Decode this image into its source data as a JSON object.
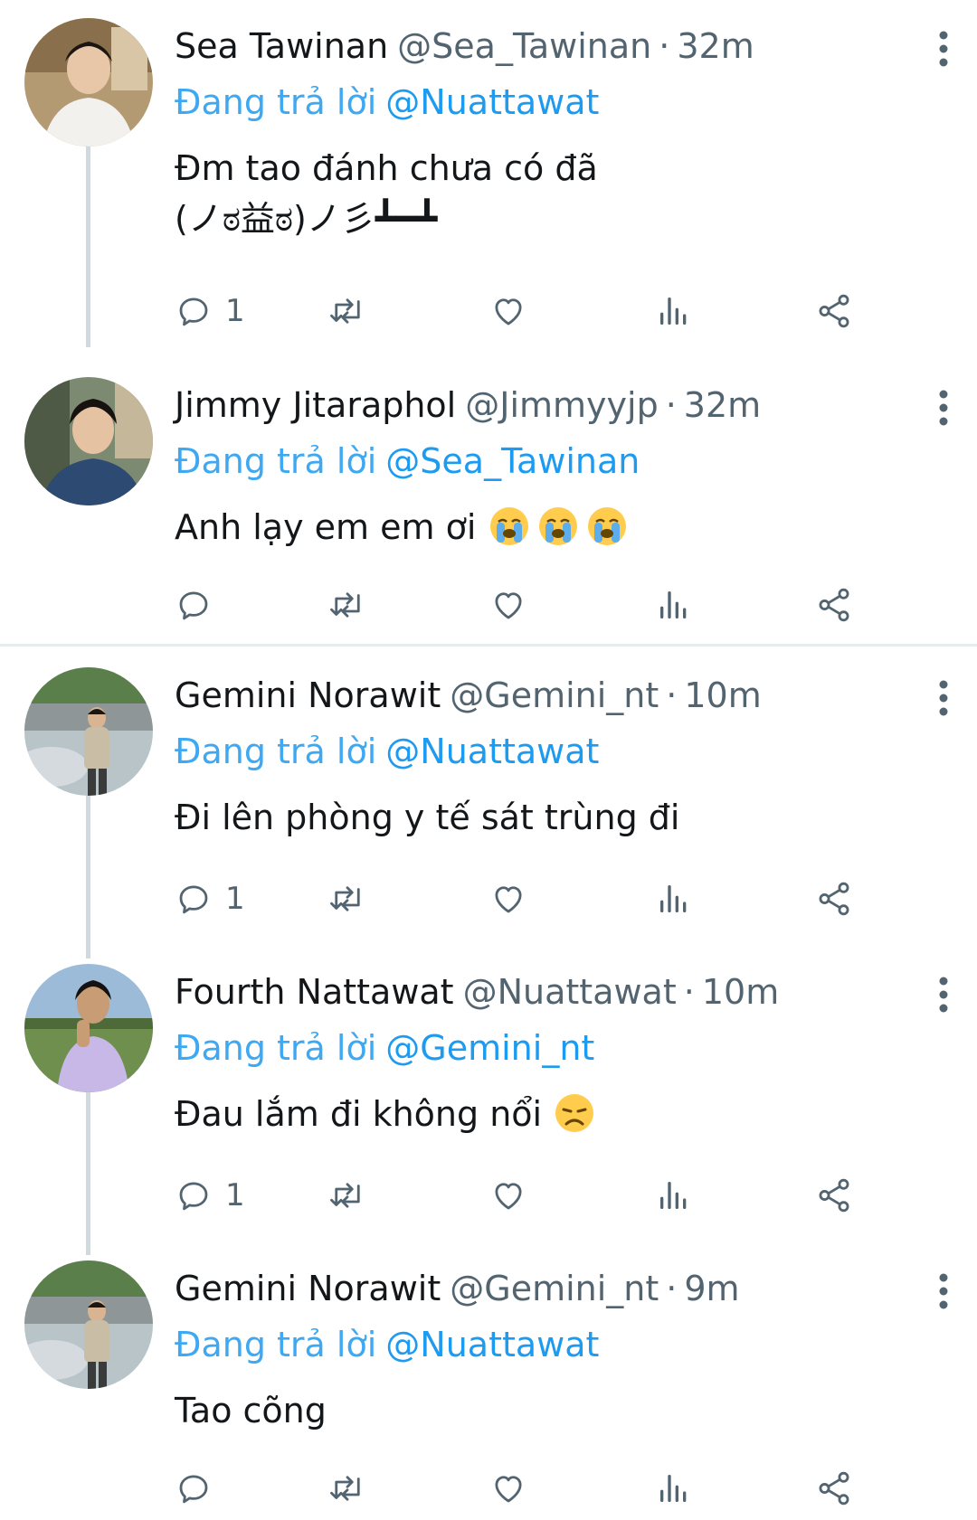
{
  "tweets": [
    {
      "name": "Sea Tawinan",
      "handle": "@Sea_Tawinan",
      "separator": "·",
      "time": "32m",
      "reply_label": "Đang trả lời",
      "reply_to": "@Nuattawat",
      "text": "Đm tao đánh chưa có đã\n(ノಠ益ಠ)ノ彡┻━┻",
      "reply_count": "1"
    },
    {
      "name": "Jimmy Jitaraphol",
      "handle": "@Jimmyyjp",
      "separator": "·",
      "time": "32m",
      "reply_label": "Đang trả lời",
      "reply_to": "@Sea_Tawinan",
      "text": "Anh lạy em em ơi ",
      "emojis": [
        "crying-face",
        "crying-face",
        "crying-face"
      ],
      "reply_count": ""
    },
    {
      "name": "Gemini Norawit",
      "handle": "@Gemini_nt",
      "separator": "·",
      "time": "10m",
      "reply_label": "Đang trả lời",
      "reply_to": "@Nuattawat",
      "text": "Đi lên phòng y tế sát trùng đi",
      "reply_count": "1"
    },
    {
      "name": "Fourth Nattawat",
      "handle": "@Nuattawat",
      "separator": "·",
      "time": "10m",
      "reply_label": "Đang trả lời",
      "reply_to": "@Gemini_nt",
      "text": "Đau lắm đi không nổi ",
      "emojis": [
        "disappointed-face"
      ],
      "reply_count": "1"
    },
    {
      "name": "Gemini Norawit",
      "handle": "@Gemini_nt",
      "separator": "·",
      "time": "9m",
      "reply_label": "Đang trả lời",
      "reply_to": "@Nuattawat",
      "text": "Tao cõng",
      "reply_count": ""
    }
  ],
  "action_icons": [
    "reply-icon",
    "retweet-icon",
    "like-icon",
    "views-icon",
    "share-icon"
  ],
  "colors": {
    "link": "#1d9bf0",
    "muted": "#536471",
    "text": "#14171a",
    "thread_line": "#cfd9de",
    "divider": "#e7ecef"
  }
}
